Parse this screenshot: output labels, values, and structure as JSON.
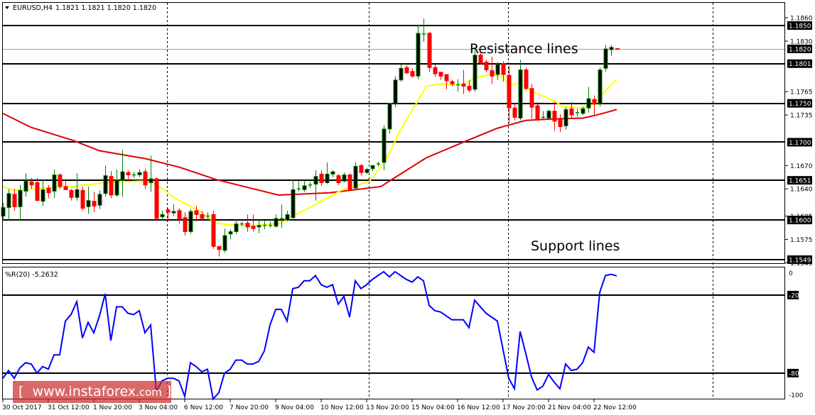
{
  "header": {
    "symbol": "EURUSD,H4",
    "quote": "1.1821 1.1821 1.1820 1.1820"
  },
  "indicator": {
    "label": "%R(20) -5.2632",
    "axis_labels": [
      "0",
      "-20",
      "-80",
      "-100"
    ],
    "levels": [
      -20,
      -80
    ],
    "color": "#0000ff"
  },
  "annotations": {
    "resistance": "Resistance lines",
    "support": "Support lines"
  },
  "watermark": {
    "text": "www.instaforex",
    "suffix": ".com",
    "open": "[",
    "close": "]"
  },
  "colors": {
    "bull": "#008000",
    "bear": "#ff0000",
    "ma_fast": "#ffff00",
    "ma_slow": "#e00000",
    "level_line": "#000000",
    "current_price_line": "#a0a0a0"
  },
  "chart_data": {
    "type": "candlestick",
    "symbol": "EURUSD",
    "timeframe": "H4",
    "ylim": [
      1.1537,
      1.187
    ],
    "price_ticks": [
      "1.1860",
      "1.1830",
      "1.1765",
      "1.1735",
      "1.1670",
      "1.1640",
      "1.1605",
      "1.1575",
      "1.1545"
    ],
    "levels": [
      "1.1850",
      "1.1801",
      "1.1750",
      "1.1700",
      "1.1651",
      "1.1600",
      "1.1549"
    ],
    "current_price": "1.1820",
    "time_labels": [
      "30 Oct 2017",
      "31 Oct 12:00",
      "1 Nov 20:00",
      "3 Nov 04:00",
      "6 Nov 12:00",
      "7 Nov 20:00",
      "9 Nov 04:00",
      "10 Nov 12:00",
      "13 Nov 20:00",
      "15 Nov 04:00",
      "16 Nov 12:00",
      "17 Nov 20:00",
      "21 Nov 04:00",
      "22 Nov 12:00"
    ],
    "ohlc": [
      [
        1.1605,
        1.1622,
        1.16,
        1.1616
      ],
      [
        1.1616,
        1.164,
        1.16,
        1.1634
      ],
      [
        1.1633,
        1.164,
        1.1612,
        1.1617
      ],
      [
        1.1617,
        1.1645,
        1.16,
        1.1638
      ],
      [
        1.1637,
        1.166,
        1.163,
        1.165
      ],
      [
        1.1649,
        1.1654,
        1.164,
        1.1645
      ],
      [
        1.1648,
        1.1654,
        1.1625,
        1.1625
      ],
      [
        1.1624,
        1.1652,
        1.1618,
        1.1639
      ],
      [
        1.1641,
        1.1645,
        1.1628,
        1.1635
      ],
      [
        1.1637,
        1.1665,
        1.1628,
        1.1658
      ],
      [
        1.1658,
        1.166,
        1.164,
        1.1643
      ],
      [
        1.1643,
        1.165,
        1.1638,
        1.1639
      ],
      [
        1.1638,
        1.164,
        1.1625,
        1.1629
      ],
      [
        1.1629,
        1.166,
        1.1625,
        1.1639
      ],
      [
        1.1638,
        1.1643,
        1.1612,
        1.1615
      ],
      [
        1.1617,
        1.1643,
        1.1608,
        1.1625
      ],
      [
        1.1624,
        1.1636,
        1.161,
        1.1618
      ],
      [
        1.1619,
        1.1638,
        1.1614,
        1.1633
      ],
      [
        1.1634,
        1.167,
        1.163,
        1.1657
      ],
      [
        1.1656,
        1.1663,
        1.1628,
        1.1632
      ],
      [
        1.1632,
        1.1665,
        1.163,
        1.1651
      ],
      [
        1.1651,
        1.169,
        1.163,
        1.1662
      ],
      [
        1.1661,
        1.1664,
        1.165,
        1.1658
      ],
      [
        1.1658,
        1.1662,
        1.1654,
        1.1658
      ],
      [
        1.1658,
        1.1665,
        1.1655,
        1.1661
      ],
      [
        1.1662,
        1.1666,
        1.164,
        1.1645
      ],
      [
        1.1648,
        1.1683,
        1.1636,
        1.1653
      ],
      [
        1.1653,
        1.1655,
        1.16,
        1.1602
      ],
      [
        1.1604,
        1.1612,
        1.16,
        1.1607
      ],
      [
        1.1613,
        1.1615,
        1.1598,
        1.161
      ],
      [
        1.1609,
        1.162,
        1.1605,
        1.1611
      ],
      [
        1.1612,
        1.1615,
        1.1595,
        1.1601
      ],
      [
        1.1603,
        1.161,
        1.158,
        1.1585
      ],
      [
        1.1585,
        1.1614,
        1.1582,
        1.1611
      ],
      [
        1.1612,
        1.1618,
        1.1598,
        1.1607
      ],
      [
        1.1607,
        1.1612,
        1.16,
        1.1602
      ],
      [
        1.1605,
        1.161,
        1.16,
        1.1605
      ],
      [
        1.1607,
        1.1612,
        1.1563,
        1.1566
      ],
      [
        1.1566,
        1.1566,
        1.1553,
        1.1562
      ],
      [
        1.1561,
        1.1589,
        1.1558,
        1.158
      ],
      [
        1.1582,
        1.1588,
        1.1575,
        1.1585
      ],
      [
        1.1585,
        1.1601,
        1.1582,
        1.1595
      ],
      [
        1.1595,
        1.1598,
        1.1592,
        1.1595
      ],
      [
        1.1596,
        1.1607,
        1.1585,
        1.1591
      ],
      [
        1.1592,
        1.1607,
        1.1585,
        1.1589
      ],
      [
        1.1591,
        1.1601,
        1.1583,
        1.1593
      ],
      [
        1.1593,
        1.1599,
        1.1588,
        1.1593
      ],
      [
        1.1593,
        1.1598,
        1.159,
        1.1593
      ],
      [
        1.1592,
        1.1607,
        1.159,
        1.1602
      ],
      [
        1.1602,
        1.162,
        1.159,
        1.1602
      ],
      [
        1.16,
        1.1612,
        1.1598,
        1.1607
      ],
      [
        1.1603,
        1.1652,
        1.16,
        1.1639
      ],
      [
        1.164,
        1.1651,
        1.1637,
        1.164
      ],
      [
        1.1639,
        1.165,
        1.1636,
        1.1644
      ],
      [
        1.1645,
        1.1649,
        1.1641,
        1.1645
      ],
      [
        1.1646,
        1.1664,
        1.1625,
        1.1656
      ],
      [
        1.1659,
        1.1664,
        1.1644,
        1.1648
      ],
      [
        1.1648,
        1.1674,
        1.1646,
        1.1659
      ],
      [
        1.1659,
        1.1664,
        1.1655,
        1.1662
      ],
      [
        1.1657,
        1.1659,
        1.1645,
        1.1648
      ],
      [
        1.165,
        1.1661,
        1.1648,
        1.1658
      ],
      [
        1.1658,
        1.166,
        1.1638,
        1.1639
      ],
      [
        1.1641,
        1.1674,
        1.1638,
        1.1669
      ],
      [
        1.167,
        1.1672,
        1.1657,
        1.1661
      ],
      [
        1.1661,
        1.1667,
        1.1659,
        1.1665
      ],
      [
        1.1666,
        1.1671,
        1.1663,
        1.167
      ],
      [
        1.1672,
        1.1675,
        1.1669,
        1.1672
      ],
      [
        1.1674,
        1.1722,
        1.1664,
        1.1717
      ],
      [
        1.1717,
        1.175,
        1.1711,
        1.175
      ],
      [
        1.1749,
        1.1785,
        1.1745,
        1.178
      ],
      [
        1.178,
        1.18,
        1.1778,
        1.1795
      ],
      [
        1.1796,
        1.1799,
        1.1788,
        1.1789
      ],
      [
        1.1791,
        1.1795,
        1.1783,
        1.1785
      ],
      [
        1.1785,
        1.1851,
        1.1781,
        1.184
      ],
      [
        1.1839,
        1.1859,
        1.1829,
        1.1839
      ],
      [
        1.184,
        1.1842,
        1.179,
        1.1796
      ],
      [
        1.1796,
        1.18,
        1.1784,
        1.1788
      ],
      [
        1.179,
        1.179,
        1.178,
        1.1785
      ],
      [
        1.1787,
        1.1787,
        1.1768,
        1.1779
      ],
      [
        1.1778,
        1.178,
        1.1772,
        1.1775
      ],
      [
        1.1774,
        1.1781,
        1.1765,
        1.1774
      ],
      [
        1.1775,
        1.1793,
        1.1762,
        1.1772
      ],
      [
        1.1772,
        1.178,
        1.1764,
        1.1767
      ],
      [
        1.1768,
        1.1818,
        1.1765,
        1.1812
      ],
      [
        1.1812,
        1.1815,
        1.18,
        1.1802
      ],
      [
        1.1803,
        1.1806,
        1.179,
        1.1793
      ],
      [
        1.1792,
        1.181,
        1.1775,
        1.1785
      ],
      [
        1.1787,
        1.1803,
        1.178,
        1.18
      ],
      [
        1.1801,
        1.1804,
        1.1778,
        1.1787
      ],
      [
        1.1786,
        1.1798,
        1.1725,
        1.1744
      ],
      [
        1.1744,
        1.175,
        1.1728,
        1.1732
      ],
      [
        1.1731,
        1.1806,
        1.1728,
        1.1793
      ],
      [
        1.1793,
        1.1796,
        1.1767,
        1.1769
      ],
      [
        1.1769,
        1.1775,
        1.173,
        1.1745
      ],
      [
        1.1747,
        1.1752,
        1.1728,
        1.173
      ],
      [
        1.1732,
        1.174,
        1.173,
        1.1732
      ],
      [
        1.1731,
        1.1742,
        1.1728,
        1.174
      ],
      [
        1.174,
        1.1752,
        1.1715,
        1.1727
      ],
      [
        1.1729,
        1.1736,
        1.1713,
        1.172
      ],
      [
        1.1721,
        1.1745,
        1.1716,
        1.1742
      ],
      [
        1.1743,
        1.1752,
        1.173,
        1.1735
      ],
      [
        1.1738,
        1.1743,
        1.1733,
        1.1738
      ],
      [
        1.1737,
        1.1746,
        1.1735,
        1.1743
      ],
      [
        1.1744,
        1.1771,
        1.1738,
        1.1756
      ],
      [
        1.1755,
        1.176,
        1.1734,
        1.1749
      ],
      [
        1.1749,
        1.1796,
        1.1746,
        1.1793
      ],
      [
        1.1795,
        1.1825,
        1.1791,
        1.182
      ],
      [
        1.1819,
        1.1825,
        1.1811,
        1.1822
      ],
      [
        1.1821,
        1.1821,
        1.182,
        1.182
      ]
    ],
    "ma_fast": [
      [
        0,
        1.1643
      ],
      [
        2,
        1.1638
      ],
      [
        7,
        1.1641
      ],
      [
        12,
        1.1643
      ],
      [
        18,
        1.1648
      ],
      [
        24.5,
        1.165
      ],
      [
        27,
        1.1646
      ],
      [
        30.5,
        1.1627
      ],
      [
        34.5,
        1.1612
      ],
      [
        37.5,
        1.1596
      ],
      [
        41,
        1.1593
      ],
      [
        44.5,
        1.1593
      ],
      [
        49,
        1.1596
      ],
      [
        51,
        1.1605
      ],
      [
        54.5,
        1.1618
      ],
      [
        59.5,
        1.1638
      ],
      [
        64.5,
        1.165
      ],
      [
        67,
        1.1673
      ],
      [
        68.5,
        1.1693
      ],
      [
        70,
        1.1717
      ],
      [
        73,
        1.1753
      ],
      [
        74.5,
        1.1772
      ],
      [
        77,
        1.1775
      ],
      [
        81,
        1.1773
      ],
      [
        83,
        1.1783
      ],
      [
        86,
        1.1787
      ],
      [
        88,
        1.1784
      ],
      [
        89,
        1.1773
      ],
      [
        91,
        1.1776
      ],
      [
        93.5,
        1.1764
      ],
      [
        97,
        1.1753
      ],
      [
        98.5,
        1.1746
      ],
      [
        102,
        1.1744
      ],
      [
        104,
        1.1749
      ],
      [
        106,
        1.1766
      ],
      [
        108,
        1.1781
      ]
    ],
    "ma_slow": [
      [
        0,
        1.1737
      ],
      [
        5,
        1.1719
      ],
      [
        12.5,
        1.1702
      ],
      [
        17,
        1.1689
      ],
      [
        25,
        1.1679
      ],
      [
        31,
        1.1668
      ],
      [
        37.5,
        1.1652
      ],
      [
        48.5,
        1.1632
      ],
      [
        57.5,
        1.1635
      ],
      [
        66.5,
        1.1643
      ],
      [
        69.5,
        1.1657
      ],
      [
        74.5,
        1.168
      ],
      [
        81,
        1.17
      ],
      [
        87,
        1.1718
      ],
      [
        89,
        1.1722
      ],
      [
        92,
        1.1728
      ],
      [
        97,
        1.173
      ],
      [
        102,
        1.1731
      ],
      [
        104.5,
        1.1735
      ],
      [
        108,
        1.1742
      ]
    ],
    "williams_r": [
      -84,
      -78,
      -84,
      -76,
      -72,
      -73,
      -80,
      -75,
      -77,
      -66,
      -66,
      -40,
      -35,
      -25,
      -53,
      -41,
      -49,
      -36,
      -19,
      -55,
      -29,
      -29,
      -34,
      -35,
      -32,
      -49,
      -43,
      -94,
      -86,
      -84,
      -84,
      -86,
      -98,
      -72,
      -75,
      -79,
      -77,
      -100,
      -95,
      -80,
      -77,
      -70,
      -70,
      -73,
      -73,
      -71,
      -63,
      -43,
      -31,
      -31,
      -40,
      -15,
      -14,
      -9,
      -9,
      -5,
      -12,
      -14,
      -12,
      -27,
      -21,
      -37,
      -9,
      -15,
      -12,
      -8,
      -5,
      -2,
      -6,
      -2,
      -5,
      -8,
      -10,
      -6,
      -9,
      -28,
      -32,
      -33,
      -36,
      -39,
      -39,
      -39,
      -45,
      -24,
      -29,
      -34,
      -37,
      -40,
      -62,
      -84,
      -92,
      -48,
      -65,
      -83,
      -93,
      -90,
      -81,
      -87,
      -92,
      -73,
      -78,
      -77,
      -72,
      -60,
      -64,
      -18,
      -5,
      -4,
      -5.2632
    ]
  }
}
